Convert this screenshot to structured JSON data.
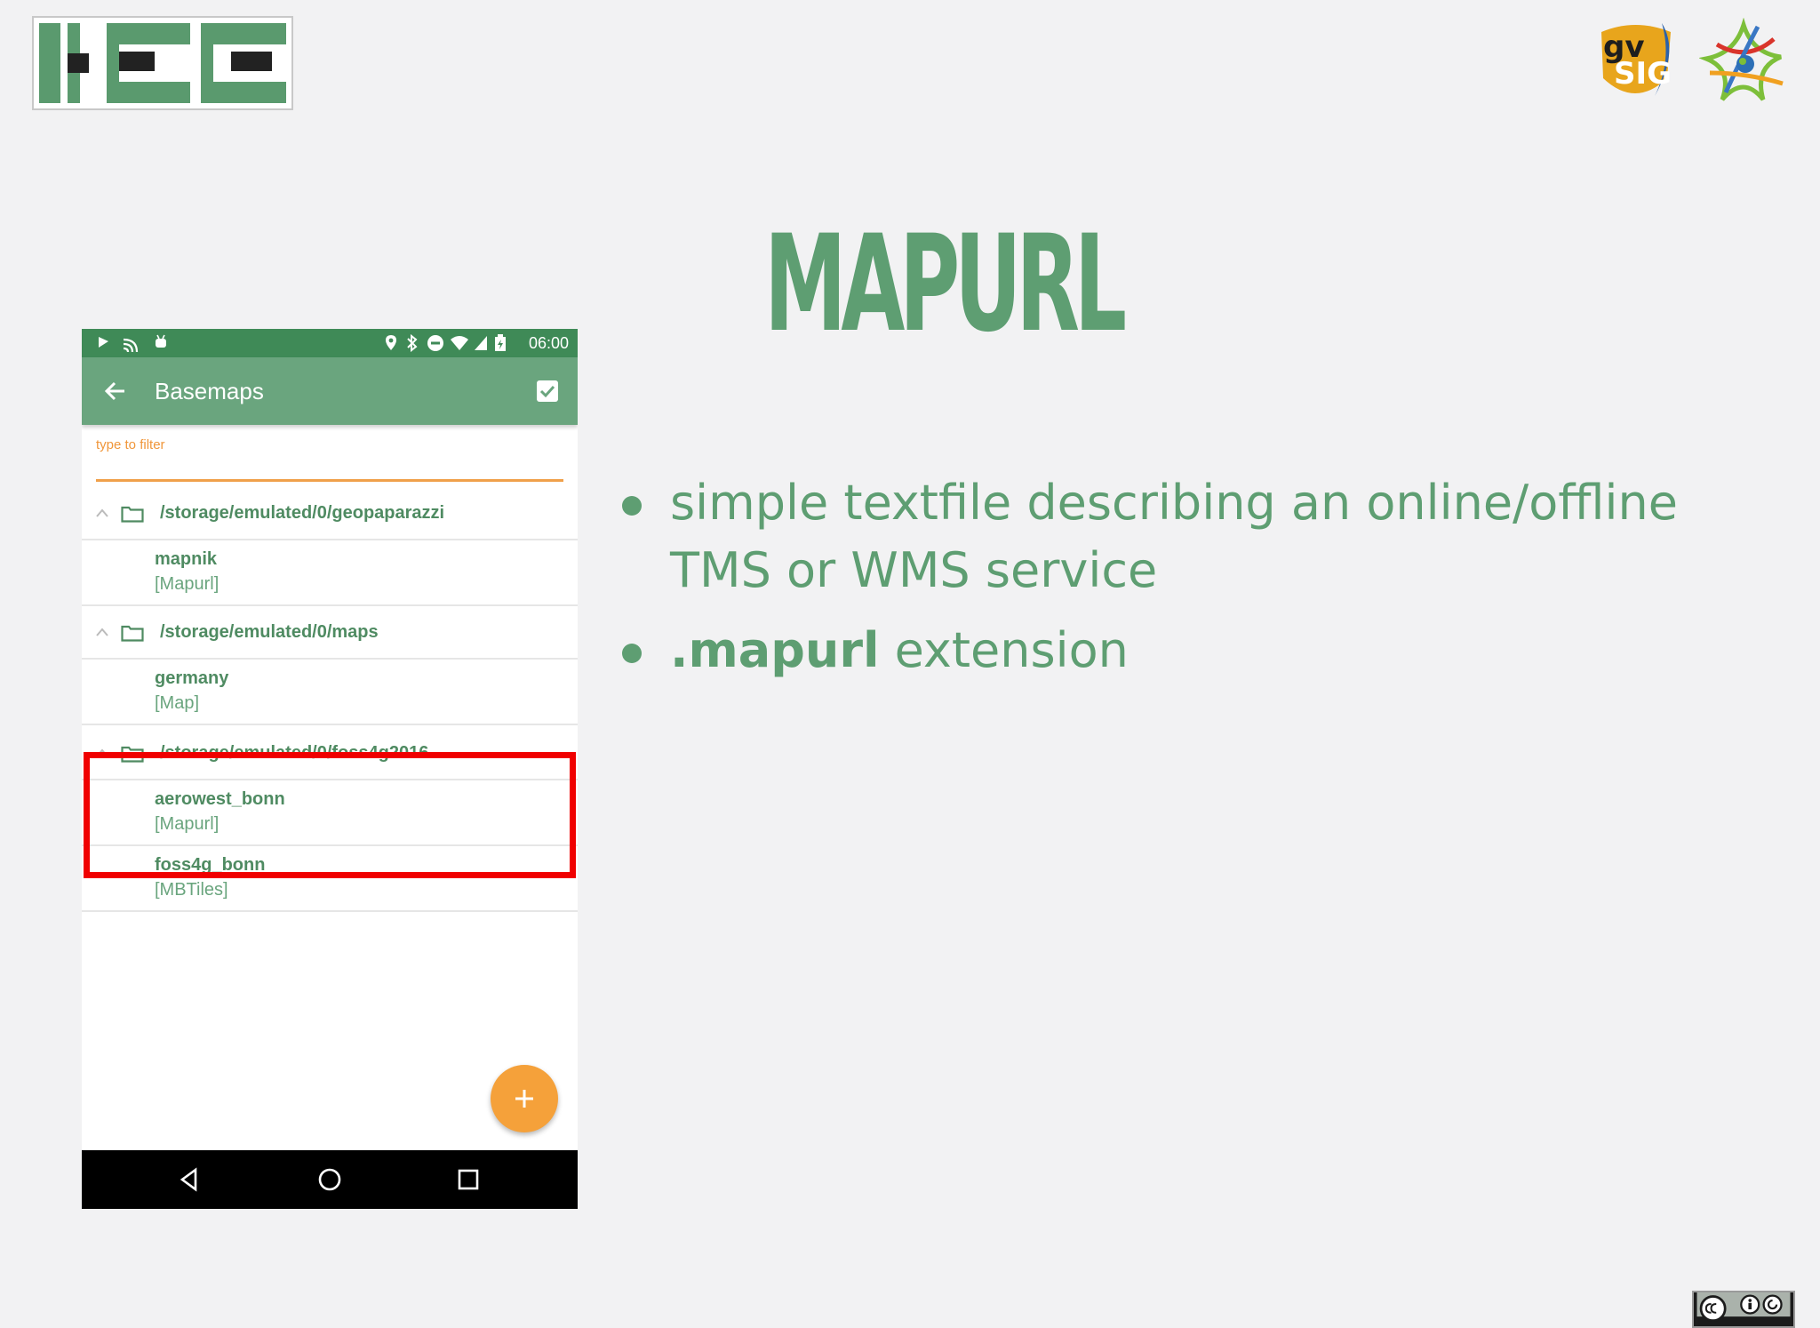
{
  "slide": {
    "title": "MAPURL",
    "bullets": [
      {
        "text": "simple textfile describing an online/offline TMS or WMS service",
        "bold_prefix": ""
      },
      {
        "bold_prefix": ".mapurl",
        "text": " extension"
      }
    ]
  },
  "phone": {
    "status_bar": {
      "time": "06:00"
    },
    "app_bar": {
      "title": "Basemaps"
    },
    "filter": {
      "label": "type to filter",
      "placeholder": "type to filter",
      "value": ""
    },
    "groups": [
      {
        "path": "/storage/emulated/0/geopaparazzi",
        "items": [
          {
            "name": "mapnik",
            "type": "[Mapurl]"
          }
        ]
      },
      {
        "path": "/storage/emulated/0/maps",
        "items": [
          {
            "name": "germany",
            "type": "[Map]"
          }
        ]
      },
      {
        "path": "/storage/emulated/0/foss4g2016",
        "items": [
          {
            "name": "aerowest_bonn",
            "type": "[Mapurl]"
          },
          {
            "name": "foss4g_bonn",
            "type": "[MBTiles]"
          }
        ]
      }
    ]
  },
  "colors": {
    "accent_green": "#5e9e72",
    "app_bar": "#6aa57e",
    "status_bar": "#3f8a57",
    "fab": "#f5a13a",
    "highlight": "#f00000"
  },
  "icons": {
    "status_left": [
      "notification-icon",
      "cast-icon",
      "android-icon"
    ],
    "status_right": [
      "location-icon",
      "bluetooth-icon",
      "do-not-disturb-icon",
      "wifi-icon",
      "signal-icon",
      "battery-icon"
    ],
    "app_bar": [
      "back-arrow-icon",
      "checkbox-icon"
    ],
    "nav": [
      "back-triangle-icon",
      "home-circle-icon",
      "recents-square-icon"
    ]
  }
}
